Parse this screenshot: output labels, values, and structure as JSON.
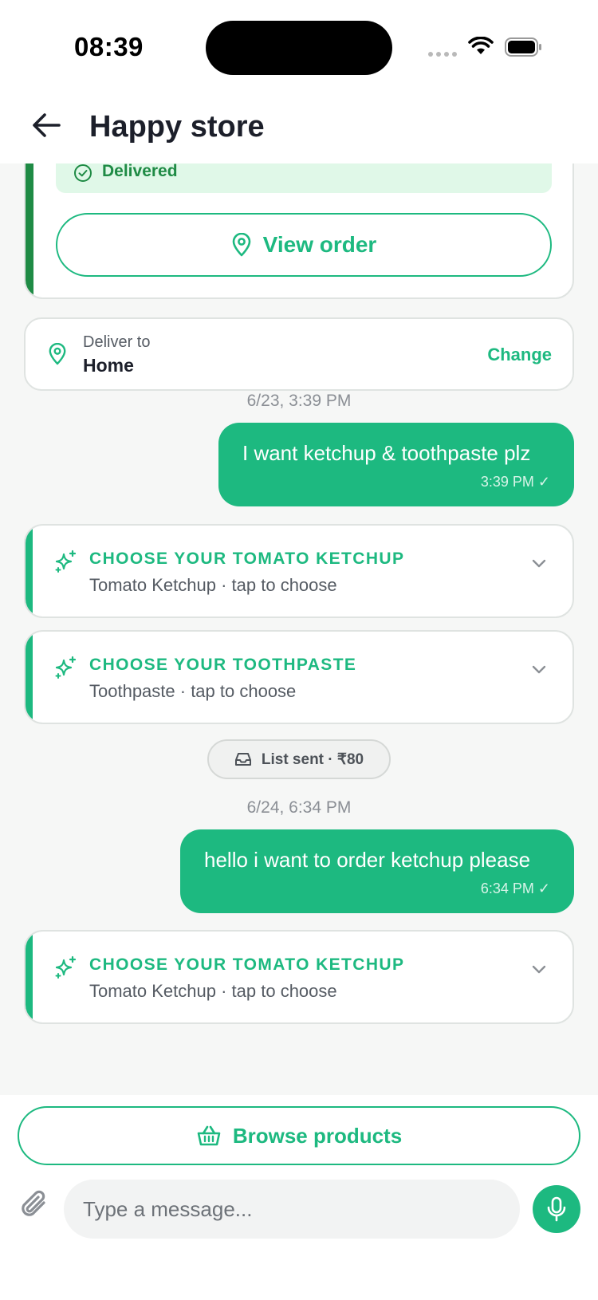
{
  "status_bar": {
    "time": "08:39"
  },
  "header": {
    "title": "Happy store"
  },
  "order_card": {
    "status": "Delivered",
    "view_order_label": "View order"
  },
  "delivery": {
    "label": "Deliver to",
    "value": "Home",
    "change_label": "Change"
  },
  "messages": [
    {
      "timestamp": "6/23, 3:39 PM",
      "text": "I want ketchup & toothpaste plz",
      "time": "3:39 PM ✓"
    },
    {
      "timestamp": "6/24, 6:34 PM",
      "text": "hello i want to order ketchup please",
      "time": "6:34 PM ✓"
    }
  ],
  "choose_cards": [
    {
      "title": "CHOOSE YOUR TOMATO KETCHUP",
      "subtitle": "Tomato Ketchup · tap to choose"
    },
    {
      "title": "CHOOSE YOUR TOOTHPASTE",
      "subtitle": "Toothpaste · tap to choose"
    },
    {
      "title": "CHOOSE YOUR TOMATO KETCHUP",
      "subtitle": "Tomato Ketchup · tap to choose"
    }
  ],
  "list_sent": {
    "label": "List sent · ₹80"
  },
  "bottom": {
    "browse_label": "Browse products",
    "input_placeholder": "Type a message..."
  },
  "colors": {
    "accent": "#1db980",
    "delivered_green": "#1f8b45",
    "delivered_bg": "#e0f8e8"
  },
  "icons": [
    "back-arrow-icon",
    "check-circle-icon",
    "location-pin-icon",
    "sparkle-icon",
    "chevron-down-icon",
    "inbox-icon",
    "basket-icon",
    "paperclip-icon",
    "microphone-icon"
  ]
}
